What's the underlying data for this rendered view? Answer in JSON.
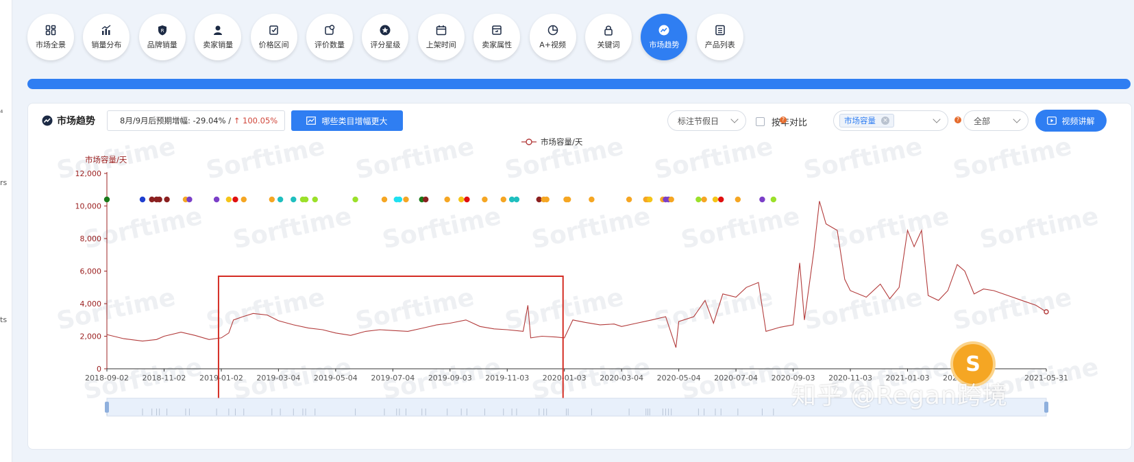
{
  "rail": {
    "fragments": [
      "⁴",
      "rs",
      "ts"
    ]
  },
  "nav": {
    "items": [
      {
        "label": "市场全景",
        "icon": "dashboard-icon",
        "active": false
      },
      {
        "label": "销量分布",
        "icon": "bar-chart-icon",
        "active": false
      },
      {
        "label": "品牌销量",
        "icon": "shield-icon",
        "active": false
      },
      {
        "label": "卖家销量",
        "icon": "seller-icon",
        "active": false
      },
      {
        "label": "价格区间",
        "icon": "price-icon",
        "active": false
      },
      {
        "label": "评价数量",
        "icon": "review-icon",
        "active": false
      },
      {
        "label": "评分星级",
        "icon": "star-icon",
        "active": false
      },
      {
        "label": "上架时间",
        "icon": "calendar-icon",
        "active": false
      },
      {
        "label": "卖家属性",
        "icon": "store-icon",
        "active": false
      },
      {
        "label": "A+视频",
        "icon": "pie-icon",
        "active": false
      },
      {
        "label": "关键词",
        "icon": "lock-icon",
        "active": false
      },
      {
        "label": "市场趋势",
        "icon": "trend-icon",
        "active": true
      },
      {
        "label": "产品列表",
        "icon": "list-icon",
        "active": false
      }
    ]
  },
  "toolbar": {
    "title": "市场趋势",
    "forecast_prefix": "8月/9月后预期增幅: -29.04% / ",
    "forecast_up": "↑ 100.05%",
    "which_button": "哪些类目增幅更大",
    "holiday_select": "标注节假日",
    "yoy_label": "按年对比",
    "metric_tag": "市场容量",
    "scope_select": "全部",
    "video_button": "视频讲解"
  },
  "watermark": "Sorftime",
  "overlay": {
    "zhihu_text": "知乎 @Regan跨境",
    "badge_letter": "S"
  },
  "colors": {
    "line": "#b23a3a",
    "accent": "#2f7ef2",
    "highlight_box": "#d42b22",
    "axis": "#9b2020"
  },
  "chart_data": {
    "type": "line",
    "legend": [
      "市场容量/天"
    ],
    "ylabel": "市场容量/天",
    "ylim": [
      0,
      12000
    ],
    "yticks": [
      "0",
      "2,000",
      "4,000",
      "6,000",
      "8,000",
      "10,000",
      "12,000"
    ],
    "x_range": [
      "2018-09-02",
      "2021-05-31"
    ],
    "xticks": [
      "2018-09-02",
      "2018-11-02",
      "2019-01-02",
      "2019-03-04",
      "2019-05-04",
      "2019-07-04",
      "2019-09-03",
      "2019-11-03",
      "2020-01-03",
      "2020-03-04",
      "2020-05-04",
      "2020-07-04",
      "2020-09-03",
      "2020-11-03",
      "2021-01-03",
      "2021-03-05",
      "2021-05-31"
    ],
    "highlight_range": [
      "2019-01-02",
      "2020-01-03"
    ],
    "series": [
      {
        "name": "市场容量/天",
        "points": [
          [
            "2018-09-02",
            2100
          ],
          [
            "2018-09-20",
            1850
          ],
          [
            "2018-10-10",
            1700
          ],
          [
            "2018-10-25",
            1800
          ],
          [
            "2018-11-02",
            2000
          ],
          [
            "2018-11-20",
            2250
          ],
          [
            "2018-12-05",
            2050
          ],
          [
            "2018-12-20",
            1800
          ],
          [
            "2019-01-02",
            1900
          ],
          [
            "2019-01-10",
            2200
          ],
          [
            "2019-01-15",
            3000
          ],
          [
            "2019-01-25",
            3200
          ],
          [
            "2019-02-05",
            3400
          ],
          [
            "2019-02-20",
            3300
          ],
          [
            "2019-03-04",
            2950
          ],
          [
            "2019-03-20",
            2700
          ],
          [
            "2019-04-05",
            2500
          ],
          [
            "2019-04-20",
            2400
          ],
          [
            "2019-05-04",
            2200
          ],
          [
            "2019-05-20",
            2050
          ],
          [
            "2019-06-05",
            2300
          ],
          [
            "2019-06-20",
            2400
          ],
          [
            "2019-07-04",
            2350
          ],
          [
            "2019-07-20",
            2300
          ],
          [
            "2019-08-05",
            2500
          ],
          [
            "2019-08-20",
            2700
          ],
          [
            "2019-09-03",
            2800
          ],
          [
            "2019-09-20",
            3000
          ],
          [
            "2019-10-05",
            2600
          ],
          [
            "2019-10-20",
            2450
          ],
          [
            "2019-11-03",
            2400
          ],
          [
            "2019-11-20",
            2300
          ],
          [
            "2019-11-25",
            3900
          ],
          [
            "2019-11-28",
            1900
          ],
          [
            "2019-12-10",
            2000
          ],
          [
            "2019-12-25",
            1950
          ],
          [
            "2020-01-03",
            1900
          ],
          [
            "2020-01-12",
            3000
          ],
          [
            "2020-01-25",
            2850
          ],
          [
            "2020-02-10",
            2700
          ],
          [
            "2020-02-25",
            2750
          ],
          [
            "2020-03-04",
            2600
          ],
          [
            "2020-03-20",
            2800
          ],
          [
            "2020-04-05",
            3000
          ],
          [
            "2020-04-20",
            3200
          ],
          [
            "2020-05-01",
            1300
          ],
          [
            "2020-05-04",
            2900
          ],
          [
            "2020-05-20",
            3200
          ],
          [
            "2020-06-01",
            4200
          ],
          [
            "2020-06-10",
            2800
          ],
          [
            "2020-06-20",
            4600
          ],
          [
            "2020-07-04",
            4400
          ],
          [
            "2020-07-15",
            5000
          ],
          [
            "2020-07-28",
            5300
          ],
          [
            "2020-08-05",
            2300
          ],
          [
            "2020-08-20",
            2550
          ],
          [
            "2020-09-03",
            2700
          ],
          [
            "2020-09-10",
            6500
          ],
          [
            "2020-09-15",
            3000
          ],
          [
            "2020-09-25",
            7200
          ],
          [
            "2020-10-01",
            10300
          ],
          [
            "2020-10-08",
            8900
          ],
          [
            "2020-10-20",
            8500
          ],
          [
            "2020-10-28",
            5500
          ],
          [
            "2020-11-03",
            4800
          ],
          [
            "2020-11-20",
            4400
          ],
          [
            "2020-12-05",
            5200
          ],
          [
            "2020-12-15",
            4300
          ],
          [
            "2020-12-25",
            5000
          ],
          [
            "2021-01-03",
            8500
          ],
          [
            "2021-01-10",
            7500
          ],
          [
            "2021-01-18",
            8500
          ],
          [
            "2021-01-25",
            4500
          ],
          [
            "2021-02-05",
            4200
          ],
          [
            "2021-02-15",
            4800
          ],
          [
            "2021-02-25",
            6400
          ],
          [
            "2021-03-05",
            6000
          ],
          [
            "2021-03-15",
            4600
          ],
          [
            "2021-03-25",
            4900
          ],
          [
            "2021-04-05",
            4800
          ],
          [
            "2021-04-20",
            4500
          ],
          [
            "2021-05-05",
            4200
          ],
          [
            "2021-05-20",
            3900
          ],
          [
            "2021-05-31",
            3500
          ]
        ]
      }
    ],
    "event_markers": [
      {
        "date": "2018-09-02",
        "color": "#1a7a1a"
      },
      {
        "date": "2018-10-10",
        "color": "#1f3fd0"
      },
      {
        "date": "2018-10-20",
        "color": "#8b2020"
      },
      {
        "date": "2018-10-25",
        "color": "#8b2020"
      },
      {
        "date": "2018-10-28",
        "color": "#8b2020"
      },
      {
        "date": "2018-11-05",
        "color": "#8b2020"
      },
      {
        "date": "2018-11-25",
        "color": "#f5a623"
      },
      {
        "date": "2018-11-29",
        "color": "#7b3fc8"
      },
      {
        "date": "2018-12-28",
        "color": "#7b3fc8"
      },
      {
        "date": "2019-01-10",
        "color": "#f5c518"
      },
      {
        "date": "2019-01-17",
        "color": "#e01010"
      },
      {
        "date": "2019-01-26",
        "color": "#f5a623"
      },
      {
        "date": "2019-02-25",
        "color": "#f5a623"
      },
      {
        "date": "2019-03-06",
        "color": "#1fbfbf"
      },
      {
        "date": "2019-03-20",
        "color": "#1fbfbf"
      },
      {
        "date": "2019-03-30",
        "color": "#9be02a"
      },
      {
        "date": "2019-04-02",
        "color": "#9be02a"
      },
      {
        "date": "2019-04-12",
        "color": "#9be02a"
      },
      {
        "date": "2019-05-25",
        "color": "#9be02a"
      },
      {
        "date": "2019-06-25",
        "color": "#f5a623"
      },
      {
        "date": "2019-07-08",
        "color": "#1fe0f0"
      },
      {
        "date": "2019-07-11",
        "color": "#1fe0f0"
      },
      {
        "date": "2019-07-18",
        "color": "#f5a623"
      },
      {
        "date": "2019-08-04",
        "color": "#1a7a1a"
      },
      {
        "date": "2019-08-08",
        "color": "#8b2020"
      },
      {
        "date": "2019-08-31",
        "color": "#f5a623"
      },
      {
        "date": "2019-09-15",
        "color": "#f5c518"
      },
      {
        "date": "2019-09-21",
        "color": "#e01010"
      },
      {
        "date": "2019-10-10",
        "color": "#f5a623"
      },
      {
        "date": "2019-10-30",
        "color": "#f5a623"
      },
      {
        "date": "2019-11-08",
        "color": "#1fbfbf"
      },
      {
        "date": "2019-11-13",
        "color": "#1fbfbf"
      },
      {
        "date": "2019-12-07",
        "color": "#8b2020"
      },
      {
        "date": "2019-12-12",
        "color": "#f5a623"
      },
      {
        "date": "2019-12-15",
        "color": "#f5a623"
      },
      {
        "date": "2020-01-05",
        "color": "#f5a623"
      },
      {
        "date": "2020-01-07",
        "color": "#f5a623"
      },
      {
        "date": "2020-02-01",
        "color": "#f5a623"
      },
      {
        "date": "2020-03-12",
        "color": "#f5a623"
      },
      {
        "date": "2020-03-30",
        "color": "#f5a623"
      },
      {
        "date": "2020-04-01",
        "color": "#f5a623"
      },
      {
        "date": "2020-04-03",
        "color": "#f5c518"
      },
      {
        "date": "2020-04-17",
        "color": "#f5a623"
      },
      {
        "date": "2020-04-20",
        "color": "#7b3fc8"
      },
      {
        "date": "2020-04-23",
        "color": "#7b3fc8"
      },
      {
        "date": "2020-04-26",
        "color": "#f5a623"
      },
      {
        "date": "2020-05-25",
        "color": "#9be02a"
      },
      {
        "date": "2020-05-31",
        "color": "#f5a623"
      },
      {
        "date": "2020-06-12",
        "color": "#f5c518"
      },
      {
        "date": "2020-06-18",
        "color": "#e01010"
      },
      {
        "date": "2020-07-06",
        "color": "#f5a623"
      },
      {
        "date": "2020-08-01",
        "color": "#7b3fc8"
      },
      {
        "date": "2020-08-13",
        "color": "#9be02a"
      }
    ]
  }
}
